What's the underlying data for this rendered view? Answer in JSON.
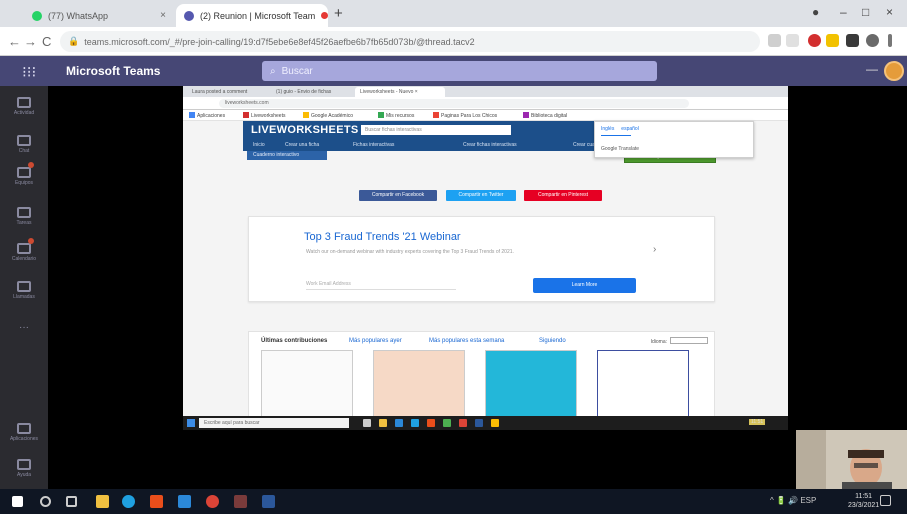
{
  "browser": {
    "tabs": [
      {
        "label": "(77) WhatsApp",
        "color": "#25d366"
      },
      {
        "label": "(2) Reunion | Microsoft Team",
        "color": "#5558af",
        "recording": "#e53935"
      }
    ],
    "new_tab": "+",
    "window_controls": {
      "min": "–",
      "max": "□",
      "close": "×"
    },
    "address": "teams.microsoft.com/_#/pre-join-calling/19:d7f5ebe6e8ef45f26aefbe6b7fb65d073b/@thread.tacv2",
    "nav": {
      "back": "←",
      "forward": "→",
      "reload": "C"
    }
  },
  "teams": {
    "title": "Microsoft Teams",
    "search_placeholder": "Buscar",
    "waffle": "⁝⁝⁝",
    "collapse": "—",
    "rail": [
      {
        "label": "Actividad"
      },
      {
        "label": "Chat"
      },
      {
        "label": "Equipos",
        "badge": true
      },
      {
        "label": "Tareas"
      },
      {
        "label": "Calendario",
        "badge": true
      },
      {
        "label": "Llamadas"
      },
      {
        "label": "···"
      },
      {
        "label": "Aplicaciones"
      },
      {
        "label": "Ayuda"
      }
    ]
  },
  "shared_screen": {
    "inner_tabs": [
      "Laura posted a comment",
      "(1) guio - Envio de fichas",
      "Liveworksheets - Nuevo ×"
    ],
    "inner_address": "liveworksheets.com",
    "bookmarks": [
      "Aplicaciones",
      "Liveworksheets",
      "Google Académico",
      "Mis recursos",
      "Paginas Para Los Chicos",
      "Biblioteca digital"
    ],
    "site": {
      "logo": "LIVEWORKSHEETS",
      "search_placeholder": "Buscar fichas interactivas",
      "nav": [
        "Inicio",
        "Crear una ficha",
        "Fichas interactivas",
        "Crear fichas interactivas",
        "Crear cuaderno"
      ],
      "submenu": "Cuaderno interactivo",
      "green_button": "Ir a mi espacio de fichas",
      "share_buttons": [
        {
          "label": "Compartir en Facebook",
          "color": "#3b5998"
        },
        {
          "label": "Compartir en Twitter",
          "color": "#1da1f2"
        },
        {
          "label": "Compartir en Pinterest",
          "color": "#e60023"
        }
      ],
      "ad": {
        "title": "Top 3 Fraud Trends '21 Webinar",
        "description": "Watch our on-demand webinar with industry experts covering the Top 3 Fraud Trends of 2021.",
        "input_placeholder": "Work Email Address",
        "button": "Learn More"
      },
      "recent": {
        "tabs": [
          "Últimas contribuciones",
          "Más populares ayer",
          "Más populares esta semana",
          "Siguiendo"
        ],
        "sort_label": "Idioma:",
        "sort_value": "Todos los idiomas"
      }
    },
    "language_popup": {
      "tab_a": "Inglés",
      "tab_b": "español",
      "option": "Google Translate"
    },
    "inner_taskbar": {
      "search": "Escribe aquí para buscar",
      "time": "11:51"
    }
  },
  "taskbar": {
    "tray": "^ 🔋 🔊 ESP",
    "time": "11:51",
    "date": "23/3/2021",
    "colors": {
      "start": "#ffffff",
      "search": "#cccccc",
      "taskview": "#cccccc",
      "explorer": "#f0c040",
      "store": "#2b88d8",
      "edge": "#1fa0e0",
      "office": "#e94e1b",
      "mail": "#2b88d8",
      "chrome": "#db4437",
      "word": "#2b579a"
    }
  },
  "colors": {
    "teams_purple": "#464775",
    "lw_blue": "#1c4f8a",
    "link_blue": "#1967d2"
  }
}
